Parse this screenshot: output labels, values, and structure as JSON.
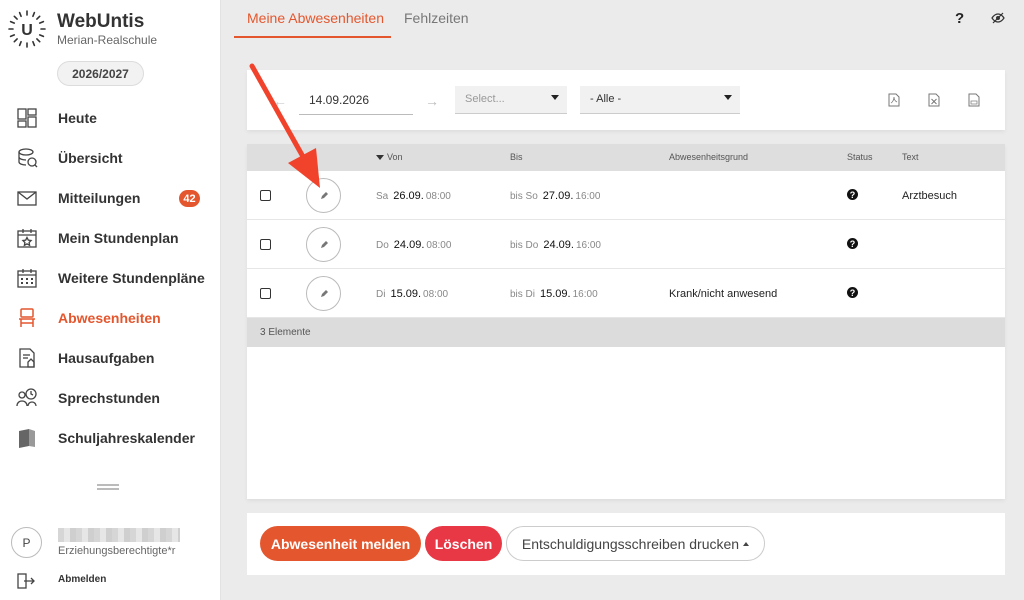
{
  "brand": {
    "name": "WebUntis",
    "school": "Merian-Realschule",
    "logo_letter": "U"
  },
  "school_year": "2026/2027",
  "nav": [
    {
      "label": "Heute",
      "icon": "dashboard-icon"
    },
    {
      "label": "Übersicht",
      "icon": "overview-icon"
    },
    {
      "label": "Mitteilungen",
      "icon": "mail-icon",
      "badge": "42"
    },
    {
      "label": "Mein Stundenplan",
      "icon": "calendar-star-icon"
    },
    {
      "label": "Weitere Stundenpläne",
      "icon": "calendar-grid-icon"
    },
    {
      "label": "Abwesenheiten",
      "icon": "chair-icon",
      "active": true
    },
    {
      "label": "Hausaufgaben",
      "icon": "homework-icon"
    },
    {
      "label": "Sprechstunden",
      "icon": "consultation-icon"
    },
    {
      "label": "Schuljahreskalender",
      "icon": "book-icon"
    }
  ],
  "user": {
    "initial": "P",
    "role": "Erziehungsberechtigte*r"
  },
  "logout_label": "Abmelden",
  "tabs": {
    "absences": "Meine Abwesenheiten",
    "missed": "Fehlzeiten"
  },
  "header": {
    "help": "?"
  },
  "filter": {
    "date": "14.09.2026",
    "select_placeholder": "Select...",
    "select_all": "- Alle -"
  },
  "table": {
    "headers": {
      "from": "Von",
      "to": "Bis",
      "reason": "Abwesenheitsgrund",
      "status": "Status",
      "text": "Text"
    },
    "rows": [
      {
        "from_dow": "Sa",
        "from_date": "26.09.",
        "from_time": "08:00",
        "to_dow": "bis So",
        "to_date": "27.09.",
        "to_time": "16:00",
        "reason": "",
        "status": "?",
        "text": "Arztbesuch"
      },
      {
        "from_dow": "Do",
        "from_date": "24.09.",
        "from_time": "08:00",
        "to_dow": "bis Do",
        "to_date": "24.09.",
        "to_time": "16:00",
        "reason": "",
        "status": "?",
        "text": ""
      },
      {
        "from_dow": "Di",
        "from_date": "15.09.",
        "from_time": "08:00",
        "to_dow": "bis Di",
        "to_date": "15.09.",
        "to_time": "16:00",
        "reason": "Krank/nicht anwesend",
        "status": "?",
        "text": ""
      }
    ],
    "footer": "3 Elemente"
  },
  "actions": {
    "report": "Abwesenheit melden",
    "delete": "Löschen",
    "print": "Entschuldigungsschreiben drucken"
  },
  "colors": {
    "accent": "#e4572e",
    "danger": "#e83845"
  }
}
